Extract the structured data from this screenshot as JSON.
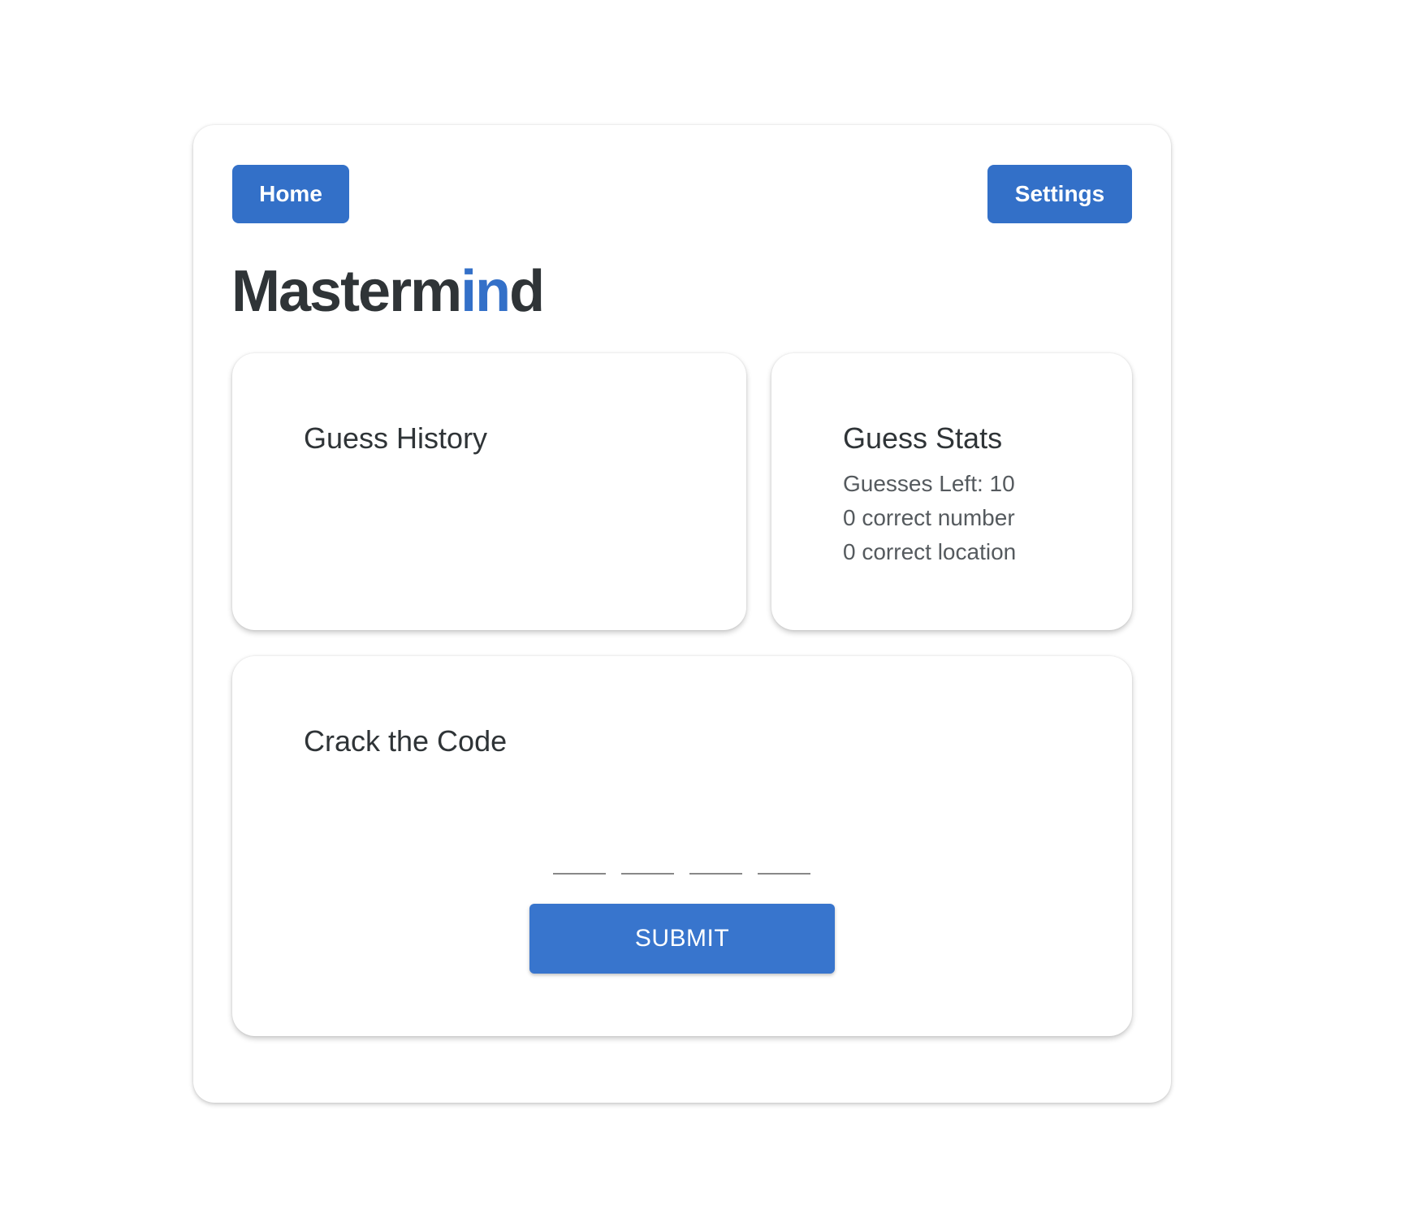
{
  "nav": {
    "home_label": "Home",
    "settings_label": "Settings"
  },
  "brand": {
    "prefix": "Masterm",
    "accent": "in",
    "suffix": "d"
  },
  "history": {
    "title": "Guess History",
    "items": []
  },
  "stats": {
    "title": "Guess Stats",
    "guesses_left": "Guesses Left: 10",
    "correct_number": "0 correct number",
    "correct_location": "0 correct location"
  },
  "code": {
    "title": "Crack the Code",
    "slots": [
      "",
      "",
      "",
      ""
    ],
    "submit_label": "SUBMIT"
  },
  "colors": {
    "accent": "#3370c8",
    "text": "#2f3437",
    "muted_text": "#555a5e",
    "background": "#ffffff"
  }
}
